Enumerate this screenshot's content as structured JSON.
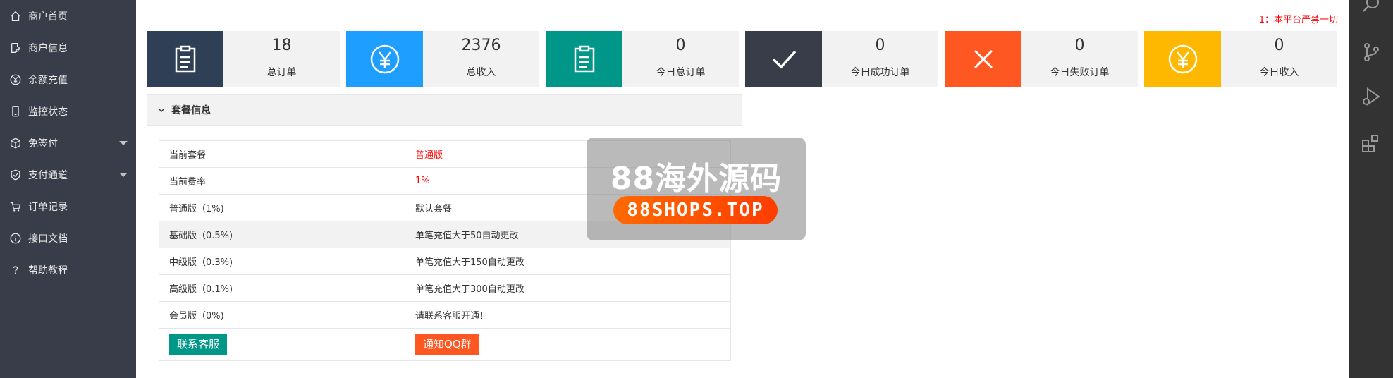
{
  "sidebar": {
    "items": [
      {
        "label": "商户首页",
        "icon": "home-icon"
      },
      {
        "label": "商户信息",
        "icon": "edit-icon"
      },
      {
        "label": "余额充值",
        "icon": "yen-circle-icon"
      },
      {
        "label": "监控状态",
        "icon": "phone-icon"
      },
      {
        "label": "免签付",
        "icon": "cube-icon",
        "has_submenu": true
      },
      {
        "label": "支付通道",
        "icon": "shield-icon",
        "has_submenu": true
      },
      {
        "label": "订单记录",
        "icon": "cart-icon"
      },
      {
        "label": "接口文档",
        "icon": "info-icon"
      },
      {
        "label": "帮助教程",
        "icon": "question-icon"
      }
    ]
  },
  "notice": "1：本平台严禁一切",
  "stats": [
    {
      "value": "18",
      "label": "总订单",
      "color": "#2f4056",
      "icon": "clipboard-icon"
    },
    {
      "value": "2376",
      "label": "总收入",
      "color": "#1e9fff",
      "icon": "yen-circle-icon"
    },
    {
      "value": "0",
      "label": "今日总订单",
      "color": "#009688",
      "icon": "clipboard-icon"
    },
    {
      "value": "0",
      "label": "今日成功订单",
      "color": "#393d49",
      "icon": "check-icon"
    },
    {
      "value": "0",
      "label": "今日失败订单",
      "color": "#ff5722",
      "icon": "close-icon"
    },
    {
      "value": "0",
      "label": "今日收入",
      "color": "#ffb800",
      "icon": "yen-circle-icon"
    }
  ],
  "package": {
    "title": "套餐信息",
    "rows": [
      {
        "key": "当前套餐",
        "value": "普通版",
        "highlight": true
      },
      {
        "key": "当前费率",
        "value": "1%",
        "highlight": true
      },
      {
        "key": "普通版（1%)",
        "value": "默认套餐"
      },
      {
        "key": "基础版（0.5%)",
        "value": "单笔充值大于50自动更改"
      },
      {
        "key": "中级版（0.3%)",
        "value": "单笔充值大于150自动更改"
      },
      {
        "key": "高级版（0.1%)",
        "value": "单笔充值大于300自动更改"
      },
      {
        "key": "会员版（0%)",
        "value": "请联系客服开通！"
      }
    ],
    "contact_button": "联系客服",
    "qq_button": "通知QQ群"
  },
  "watermark": {
    "title": "88海外源码",
    "site": "88SHOPS.TOP"
  },
  "rightbar": {
    "icons": [
      "search-icon",
      "source-control-icon",
      "run-debug-icon",
      "extensions-icon"
    ]
  }
}
